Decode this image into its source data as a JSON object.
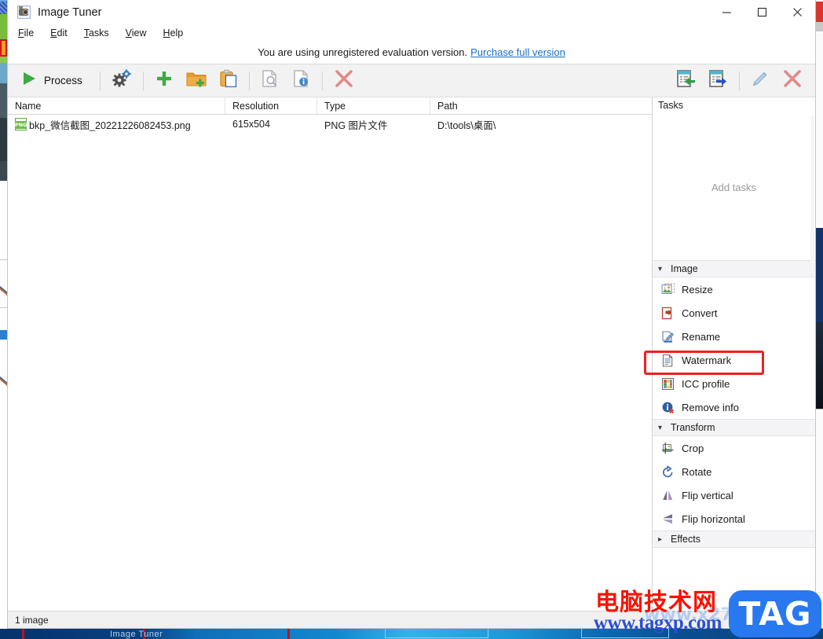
{
  "window": {
    "title": "Image Tuner",
    "icon": "camera-icon",
    "controls": [
      {
        "name": "minimize",
        "glyph": "minimize-icon"
      },
      {
        "name": "maximize",
        "glyph": "maximize-icon"
      },
      {
        "name": "close",
        "glyph": "close-icon"
      }
    ]
  },
  "menu": {
    "items": [
      {
        "label": "File",
        "accel": "F"
      },
      {
        "label": "Edit",
        "accel": "E"
      },
      {
        "label": "Tasks",
        "accel": "T"
      },
      {
        "label": "View",
        "accel": "V"
      },
      {
        "label": "Help",
        "accel": "H"
      }
    ]
  },
  "nagbar": {
    "text": "You are using unregistered evaluation version.",
    "link": "Purchase full version"
  },
  "toolbar": {
    "process_label": "Process",
    "left_buttons": [
      {
        "name": "process-button",
        "icon": "play-icon",
        "label": "Process"
      },
      {
        "name": "settings-button",
        "icon": "gears-icon"
      },
      {
        "name": "add-files-button",
        "icon": "plus-icon"
      },
      {
        "name": "add-folder-button",
        "icon": "folder-add-icon"
      },
      {
        "name": "paste-button",
        "icon": "clipboard-paste-icon"
      },
      {
        "name": "preview-button",
        "icon": "page-search-icon"
      },
      {
        "name": "info-button",
        "icon": "page-info-icon"
      },
      {
        "name": "remove-button",
        "icon": "red-x-icon"
      }
    ],
    "right_buttons": [
      {
        "name": "import-list-button",
        "icon": "list-import-icon"
      },
      {
        "name": "export-list-button",
        "icon": "list-export-icon"
      },
      {
        "name": "edit-task-button",
        "icon": "pencil-icon"
      },
      {
        "name": "delete-task-button",
        "icon": "red-x-icon"
      }
    ]
  },
  "filelist": {
    "columns": [
      "Name",
      "Resolution",
      "Type",
      "Path"
    ],
    "rows": [
      {
        "icon": "png-file-icon",
        "name": "bkp_微信截图_20221226082453.png",
        "resolution": "615x504",
        "type": "PNG 图片文件",
        "path": "D:\\tools\\桌面\\"
      }
    ]
  },
  "taskpanel": {
    "header": "Tasks",
    "empty_text": "Add tasks",
    "groups": [
      {
        "label": "Image",
        "expanded": true,
        "chevron": "chevron-down-icon",
        "items": [
          {
            "label": "Resize",
            "icon": "resize-icon",
            "highlighted": false
          },
          {
            "label": "Convert",
            "icon": "convert-icon",
            "highlighted": false
          },
          {
            "label": "Rename",
            "icon": "rename-icon",
            "highlighted": false
          },
          {
            "label": "Watermark",
            "icon": "watermark-icon",
            "highlighted": true
          },
          {
            "label": "ICC profile",
            "icon": "icc-profile-icon",
            "highlighted": false
          },
          {
            "label": "Remove info",
            "icon": "remove-info-icon",
            "highlighted": false
          }
        ]
      },
      {
        "label": "Transform",
        "expanded": true,
        "chevron": "chevron-down-icon",
        "items": [
          {
            "label": "Crop",
            "icon": "crop-icon",
            "highlighted": false
          },
          {
            "label": "Rotate",
            "icon": "rotate-icon",
            "highlighted": false
          },
          {
            "label": "Flip vertical",
            "icon": "flip-vertical-icon",
            "highlighted": false
          },
          {
            "label": "Flip horizontal",
            "icon": "flip-horizontal-icon",
            "highlighted": false
          }
        ]
      },
      {
        "label": "Effects",
        "expanded": false,
        "chevron": "chevron-right-icon",
        "items": []
      }
    ]
  },
  "statusbar": {
    "text": "1 image"
  },
  "watermark": {
    "chinese": "电脑技术网",
    "url": "www.tagxp.com",
    "badge": "TAG",
    "ghost": "www.x27.com",
    "colors": {
      "chinese": "#fa1200",
      "url": "#2b4fd8",
      "badge_bg": "#2878f0"
    }
  },
  "taskbar": {
    "label": "Image Tuner"
  },
  "colors": {
    "accent_link": "#1a6fc4",
    "highlight_box": "#f21f1f",
    "toolbar_bg": "#f2f2f2",
    "group_header_bg": "#f4f4f6"
  }
}
